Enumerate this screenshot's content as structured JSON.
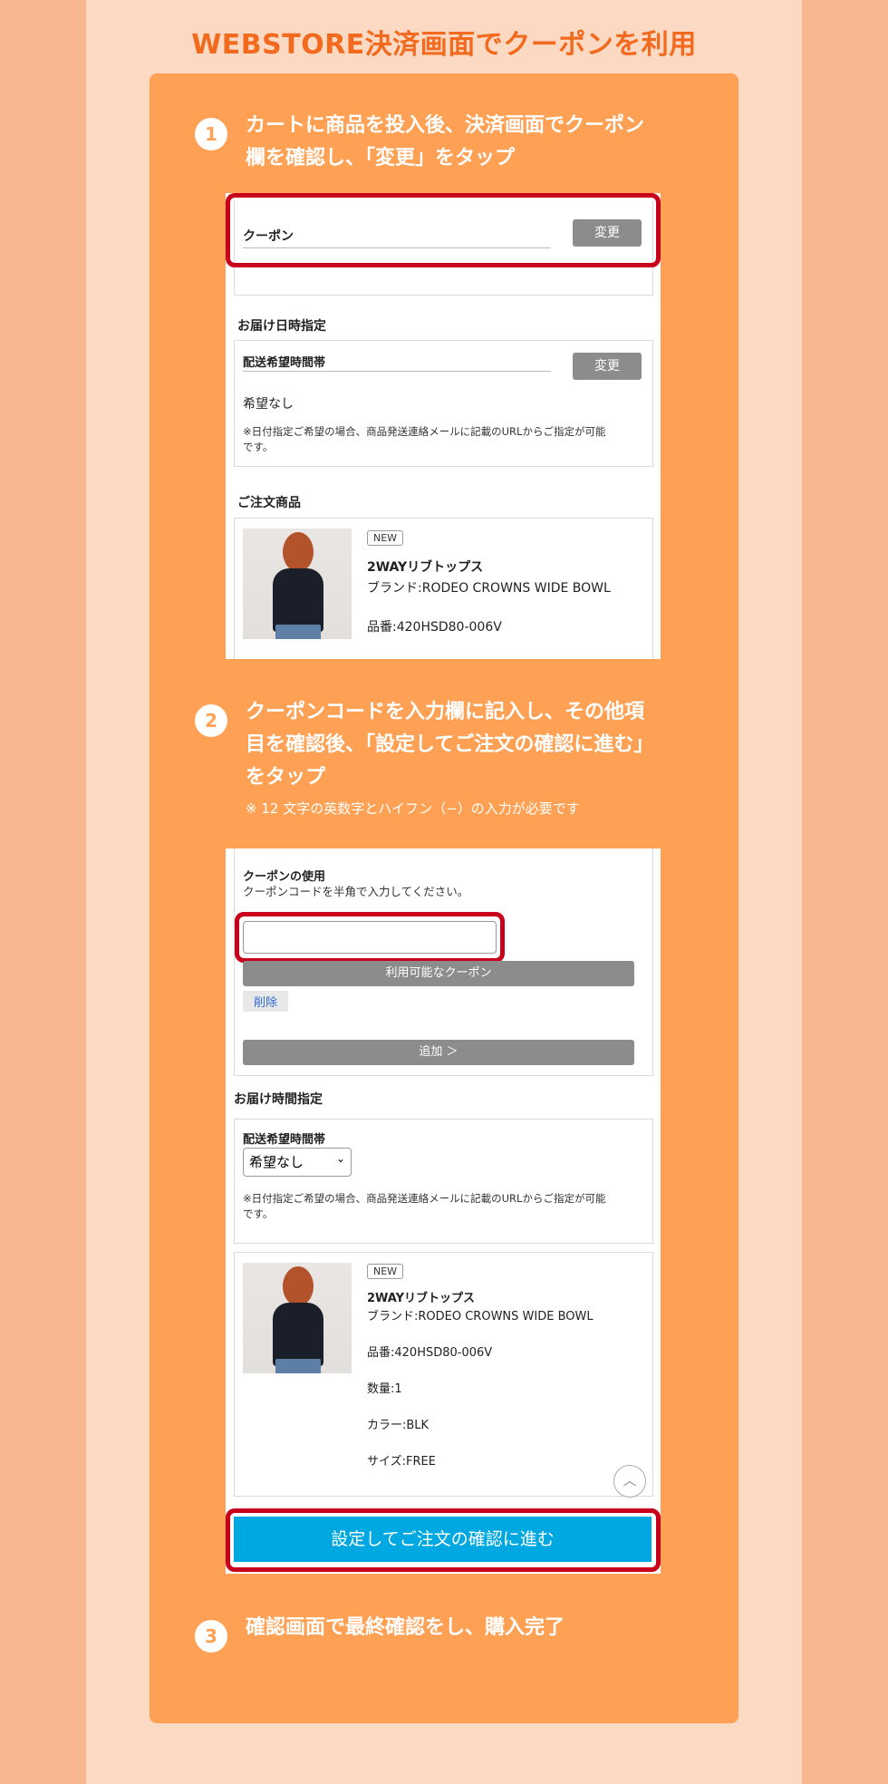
{
  "title": "WEBSTORE決済画面でクーポンを利用",
  "steps": [
    {
      "num": "1",
      "line1": "カートに商品を投入後、決済画面でクーポン",
      "line2": "欄を確認し、「変更」をタップ"
    },
    {
      "num": "2",
      "line1": "クーポンコードを入力欄に記入し、その他項",
      "line2": "目を確認後、「設定してご注文の確認に進む」",
      "line3": "をタップ",
      "note": "※ 12 文字の英数字とハイフン（−）の入力が必要です"
    },
    {
      "num": "3",
      "line1": "確認画面で最終確認をし、購入完了"
    }
  ],
  "shot1": {
    "coupon_label": "クーポン",
    "change_btn": "変更",
    "delivery_heading": "お届け日時指定",
    "time_label": "配送希望時間帯",
    "change_btn2": "変更",
    "no_preference": "希望なし",
    "date_note_1": "※日付指定ご希望の場合、商品発送連絡メールに記載のURLからご指定が可能",
    "date_note_2": "です。",
    "order_heading": "ご注文商品",
    "badge": "NEW",
    "product_name": "2WAYリブトップス",
    "brand": "ブランド:RODEO CROWNS WIDE BOWL",
    "sku": "品番:420HSD80-006V"
  },
  "shot2": {
    "coupon_use": "クーポンの使用",
    "coupon_hint": "クーポンコードを半角で入力してください。",
    "coupon_input_value": "",
    "available_btn": "利用可能なクーポン",
    "delete_link": "削除",
    "add_btn": "追加 ＞",
    "delivery_heading": "お届け時間指定",
    "time_label": "配送希望時間帯",
    "select_value": "希望なし",
    "date_note_1": "※日付指定ご希望の場合、商品発送連絡メールに記載のURLからご指定が可能",
    "date_note_2": "です。",
    "badge": "NEW",
    "product_name": "2WAYリブトップス",
    "brand": "ブランド:RODEO CROWNS WIDE BOWL",
    "sku": "品番:420HSD80-006V",
    "qty": "数量:1",
    "color": "カラー:BLK",
    "size": "サイズ:FREE",
    "proceed_btn": "設定してご注文の確認に進む",
    "up_icon": "chevron-up-icon"
  }
}
